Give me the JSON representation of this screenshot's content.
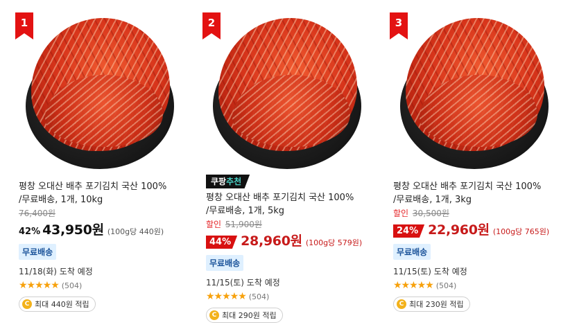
{
  "products": [
    {
      "rank": "1",
      "badge": null,
      "title": "평창 오대산 배추 포기김치 국산 100% /무료배송, 1개, 10kg",
      "original_price": "76,400원",
      "discount_label": null,
      "discount": "42%",
      "price": "43,950원",
      "unit_price": "(100g당 440원)",
      "shipping": "무료배송",
      "delivery": "11/18(화) 도착 예정",
      "stars": "★★★★★",
      "rating": 4.5,
      "reviews": "(504)",
      "reward": "최대 440원 적립",
      "coin": "C"
    },
    {
      "rank": "2",
      "badge": {
        "prefix": "쿠팡",
        "suffix": "추천"
      },
      "title": "평창 오대산 배추 포기김치 국산 100% /무료배송, 1개, 5kg",
      "original_price": "51,900원",
      "discount_label": "할인",
      "discount": "44%",
      "price": "28,960원",
      "unit_price": "(100g당 579원)",
      "shipping": "무료배송",
      "delivery": "11/15(토) 도착 예정",
      "stars": "★★★★★",
      "rating": 4.5,
      "reviews": "(504)",
      "reward": "최대 290원 적립",
      "coin": "C"
    },
    {
      "rank": "3",
      "badge": null,
      "title": "평창 오대산 배추 포기김치 국산 100% /무료배송, 1개, 3kg",
      "original_price": "30,500원",
      "discount_label": "할인",
      "discount": "24%",
      "price": "22,960원",
      "unit_price": "(100g당 765원)",
      "shipping": "무료배송",
      "delivery": "11/15(토) 도착 예정",
      "stars": "★★★★★",
      "rating": 4.5,
      "reviews": "(504)",
      "reward": "최대 230원 적립",
      "coin": "C"
    }
  ],
  "colors": {
    "rank_badge": "#e31212",
    "discount_red": "#d81010",
    "price_red": "#c71a1a",
    "star": "#f7a10c",
    "free_shipping_bg": "#dff0ff",
    "coupang_accent": "#4bd2c7"
  }
}
